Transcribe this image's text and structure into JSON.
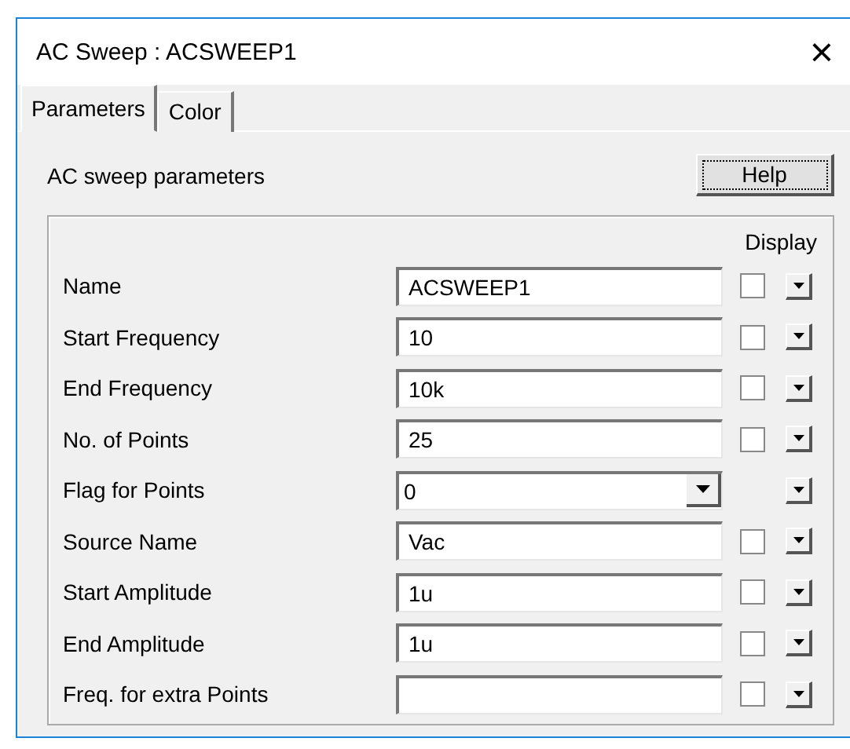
{
  "window": {
    "title": "AC Sweep : ACSWEEP1",
    "close": "×"
  },
  "tabs": [
    {
      "label": "Parameters",
      "selected": true
    },
    {
      "label": "Color",
      "selected": false
    }
  ],
  "heading": "AC sweep parameters",
  "help_button": "Help",
  "display_header": "Display",
  "rows": [
    {
      "kind": "text",
      "label": "Name",
      "value": "ACSWEEP1",
      "checked": false
    },
    {
      "kind": "text",
      "label": "Start Frequency",
      "value": "10",
      "checked": false
    },
    {
      "kind": "text",
      "label": "End Frequency",
      "value": "10k",
      "checked": false
    },
    {
      "kind": "text",
      "label": "No. of Points",
      "value": "25",
      "checked": false
    },
    {
      "kind": "combo",
      "label": "Flag for Points",
      "value": "0"
    },
    {
      "kind": "text",
      "label": "Source Name",
      "value": "Vac",
      "checked": false
    },
    {
      "kind": "text",
      "label": "Start Amplitude",
      "value": "1u",
      "checked": false
    },
    {
      "kind": "text",
      "label": "End Amplitude",
      "value": "1u",
      "checked": false
    },
    {
      "kind": "text",
      "label": "Freq. for extra Points",
      "checked": false
    }
  ]
}
